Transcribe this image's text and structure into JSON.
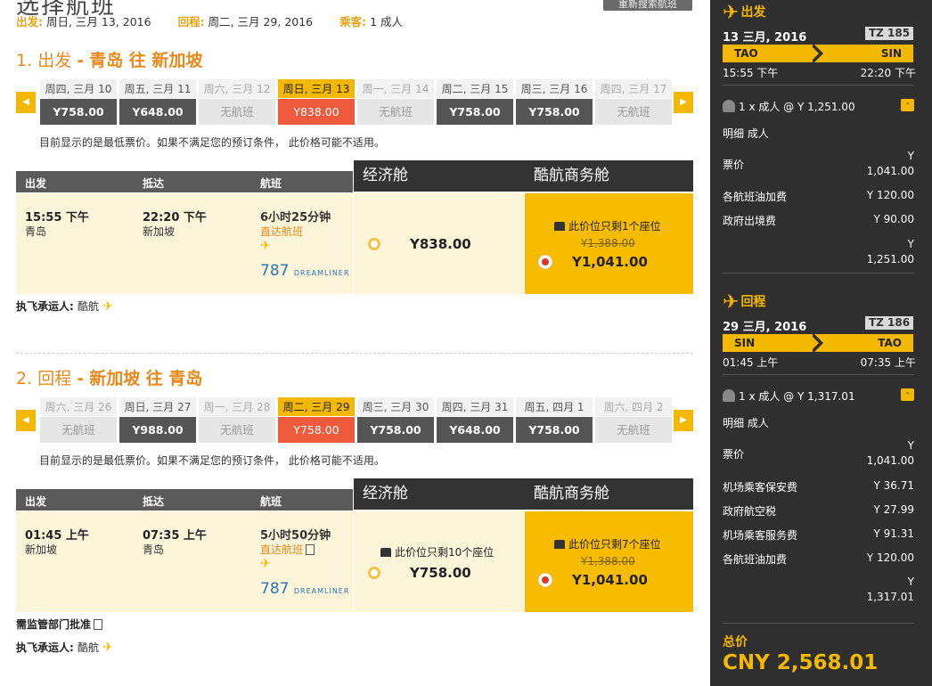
{
  "header": {
    "title": "选择航班",
    "research_button": "重新搜索航班",
    "depart_label": "出发:",
    "depart_value": "周日, 三月 13, 2016",
    "return_label": "回程:",
    "return_value": "周二, 三月 29, 2016",
    "pax_label": "乘客:",
    "pax_value": "1 成人"
  },
  "outbound": {
    "number": "1.",
    "title_kind": "出发",
    "title_route": "青岛 往 新加坡",
    "days": [
      {
        "label": "周四, 三月 10",
        "price": "Y758.00",
        "state": "avail"
      },
      {
        "label": "周五, 三月 11",
        "price": "Y648.00",
        "state": "avail"
      },
      {
        "label": "周六, 三月 12",
        "price": "无航班",
        "state": "na"
      },
      {
        "label": "周日, 三月 13",
        "price": "Y838.00",
        "state": "sel"
      },
      {
        "label": "周一, 三月 14",
        "price": "无航班",
        "state": "na"
      },
      {
        "label": "周二, 三月 15",
        "price": "Y758.00",
        "state": "avail"
      },
      {
        "label": "周三, 三月 16",
        "price": "Y758.00",
        "state": "avail"
      },
      {
        "label": "周四, 三月 17",
        "price": "无航班",
        "state": "na"
      }
    ],
    "note": "目前显示的是最低票价。如果不满足您的预订条件， 此价格可能不适用。",
    "col_depart": "出发",
    "col_arrive": "抵达",
    "col_flight": "航班",
    "economy_header": "经济舱",
    "business_header": "酷航商务舱",
    "dep_time": "15:55 下午",
    "dep_city": "青岛",
    "arr_time": "22:20 下午",
    "arr_city": "新加坡",
    "duration": "6小时25分钟",
    "direct": "直达航班",
    "aircraft_num": "787",
    "aircraft_name": "DREAMLINER",
    "economy_price": "Y838.00",
    "business_seats": "此价位只剩1个座位",
    "business_old": "Y1,388.00",
    "business_price": "Y1,041.00",
    "carrier_label": "执飞承运人:",
    "carrier": "酷航"
  },
  "inbound": {
    "number": "2.",
    "title_kind": "回程",
    "title_route": "新加坡 往 青岛",
    "days": [
      {
        "label": "周六, 三月 26",
        "price": "无航班",
        "state": "na"
      },
      {
        "label": "周日, 三月 27",
        "price": "Y988.00",
        "state": "avail"
      },
      {
        "label": "周一, 三月 28",
        "price": "无航班",
        "state": "na"
      },
      {
        "label": "周二, 三月 29",
        "price": "Y758.00",
        "state": "sel"
      },
      {
        "label": "周三, 三月 30",
        "price": "Y758.00",
        "state": "avail"
      },
      {
        "label": "周四, 三月 31",
        "price": "Y648.00",
        "state": "avail"
      },
      {
        "label": "周五, 四月 1",
        "price": "Y758.00",
        "state": "avail"
      },
      {
        "label": "周六, 四月 2",
        "price": "无航班",
        "state": "na"
      }
    ],
    "note": "目前显示的是最低票价。如果不满足您的预订条件， 此价格可能不适用。",
    "col_depart": "出发",
    "col_arrive": "抵达",
    "col_flight": "航班",
    "economy_header": "经济舱",
    "business_header": "酷航商务舱",
    "dep_time": "01:45 上午",
    "dep_city": "新加坡",
    "arr_time": "07:35 上午",
    "arr_city": "青岛",
    "duration": "5小时50分钟",
    "direct": "直达航班",
    "aircraft_num": "787",
    "aircraft_name": "DREAMLINER",
    "economy_seats": "此价位只剩10个座位",
    "economy_price": "Y758.00",
    "business_seats": "此价位只剩7个座位",
    "business_old": "Y1,388.00",
    "business_price": "Y1,041.00",
    "approval": "需监管部门批准",
    "carrier_label": "执飞承运人:",
    "carrier": "酷航"
  },
  "summary": {
    "out": {
      "heading": "出发",
      "date": "13 三月, 2016",
      "flight_no": "TZ 185",
      "from": "TAO",
      "to": "SIN",
      "dep": "15:55 下午",
      "arr": "22:20 下午",
      "pax": "1 x 成人 @ Y 1,251.00",
      "detail": "明细 成人",
      "fees": [
        {
          "label": "票价",
          "amount_top": "Y",
          "amount": "1,041.00"
        },
        {
          "label": "各航班油加费",
          "amount": "Y 120.00"
        },
        {
          "label": "政府出境费",
          "amount": "Y 90.00"
        }
      ],
      "total_top": "Y",
      "total": "1,251.00"
    },
    "ret": {
      "heading": "回程",
      "date": "29 三月, 2016",
      "flight_no": "TZ 186",
      "from": "SIN",
      "to": "TAO",
      "dep": "01:45 上午",
      "arr": "07:35 上午",
      "pax": "1 x 成人 @ Y 1,317.01",
      "detail": "明细 成人",
      "fees": [
        {
          "label": "票价",
          "amount_top": "Y",
          "amount": "1,041.00"
        },
        {
          "label": "机场乘客保安费",
          "amount": "Y 36.71"
        },
        {
          "label": "政府航空税",
          "amount": "Y 27.99"
        },
        {
          "label": "机场乘客服务费",
          "amount": "Y 91.31"
        },
        {
          "label": "各航班油加费",
          "amount": "Y 120.00"
        }
      ],
      "total_top": "Y",
      "total": "1,317.01"
    },
    "total_label": "总价",
    "total_value": "CNY 2,568.01"
  },
  "icons": {
    "plane": "plane-icon",
    "seat": "seat-icon",
    "passenger": "passenger-icon",
    "document": "document-icon"
  },
  "colors": {
    "accent": "#f5b800",
    "orange_text": "#e8891c",
    "selected_price": "#ee5a3c",
    "dark": "#333333"
  }
}
